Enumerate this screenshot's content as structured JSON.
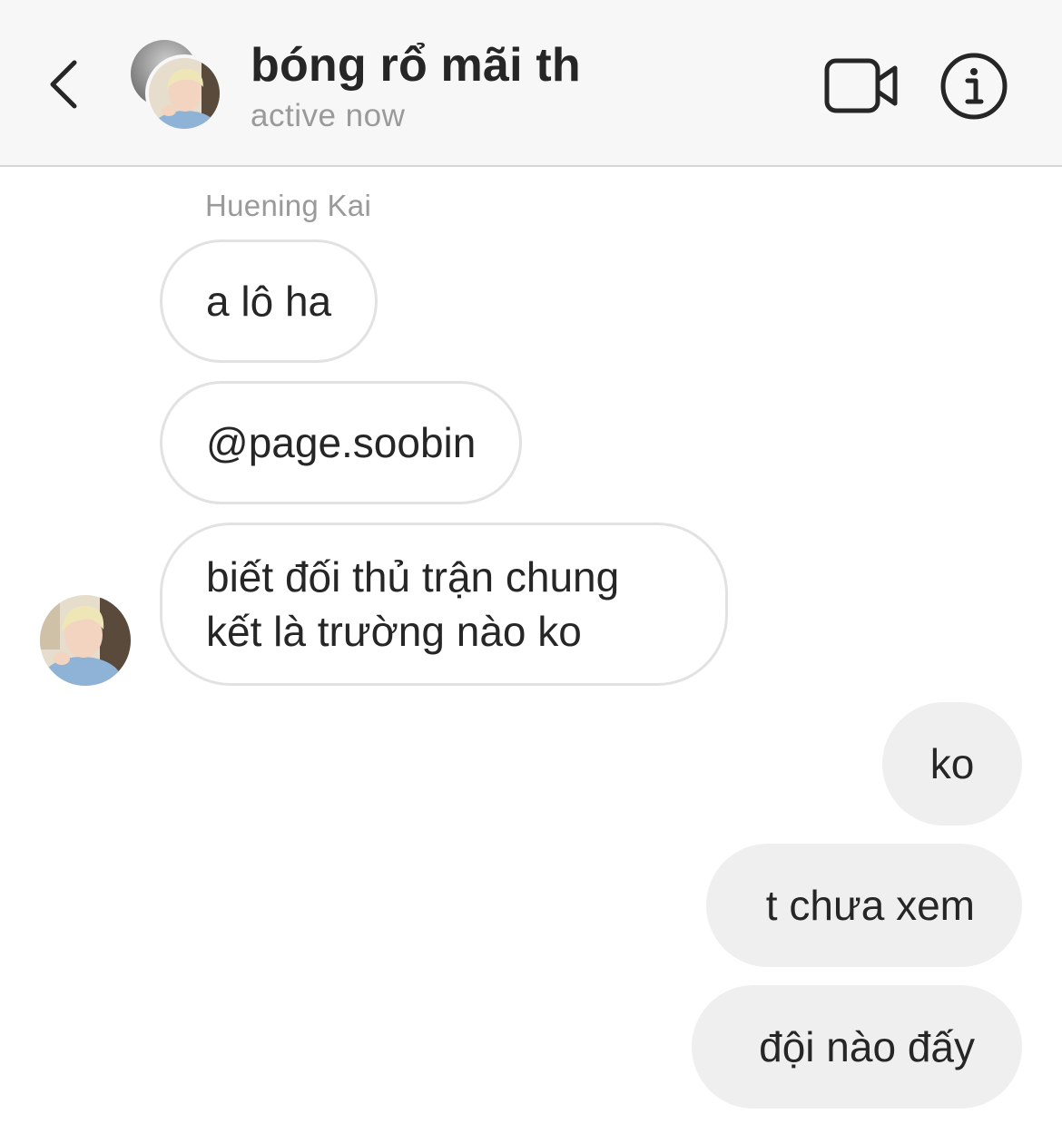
{
  "header": {
    "title": "bóng rổ mãi th",
    "status": "active now",
    "icons": {
      "back": "chevron-left-icon",
      "video": "video-camera-icon",
      "info": "info-icon"
    }
  },
  "thread": {
    "sender_name": "Huening Kai",
    "incoming": [
      {
        "text": "a lô ha"
      },
      {
        "text": "@page.soobin"
      },
      {
        "text": "biết đối thủ trận chung kết là trường nào ko"
      }
    ],
    "outgoing": [
      {
        "text": "ko"
      },
      {
        "text": "t chưa xem"
      },
      {
        "text": "đội nào đấy"
      }
    ]
  },
  "colors": {
    "header_bg": "#f7f7f7",
    "incoming_bubble_border": "#e2e2e2",
    "outgoing_bubble_bg": "#efefef",
    "secondary_text": "#9a9a9a",
    "primary_text": "#262626"
  }
}
